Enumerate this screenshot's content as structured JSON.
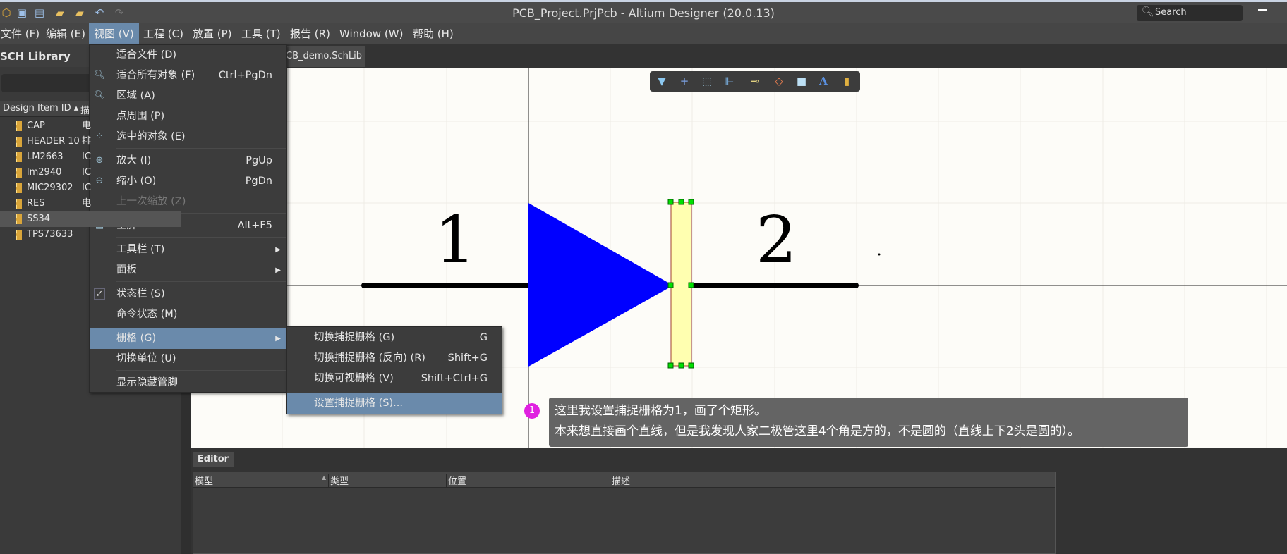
{
  "window": {
    "title": "PCB_Project.PrjPcb - Altium Designer (20.0.13)",
    "search_placeholder": "Search"
  },
  "quick_access": [
    "app-logo-icon",
    "save-icon",
    "save-all-icon",
    "open-icon",
    "open-project-icon",
    "undo-icon",
    "redo-icon"
  ],
  "menubar": [
    {
      "label": "文件 (F)"
    },
    {
      "label": "编辑 (E)"
    },
    {
      "label": "视图 (V)",
      "active": true
    },
    {
      "label": "工程 (C)"
    },
    {
      "label": "放置 (P)"
    },
    {
      "label": "工具 (T)"
    },
    {
      "label": "报告 (R)"
    },
    {
      "label": "Window (W)"
    },
    {
      "label": "帮助 (H)"
    }
  ],
  "left_panel": {
    "title": "SCH Library",
    "columns": [
      "Design Item ID",
      "描"
    ],
    "items": [
      {
        "id": "CAP",
        "desc": "电"
      },
      {
        "id": "HEADER 10",
        "desc": "排"
      },
      {
        "id": "LM2663",
        "desc": "IC"
      },
      {
        "id": "lm2940",
        "desc": "IC"
      },
      {
        "id": "MIC29302",
        "desc": "IC"
      },
      {
        "id": "RES",
        "desc": "电"
      },
      {
        "id": "SS34",
        "desc": "",
        "selected": true
      },
      {
        "id": "TPS73633",
        "desc": ""
      }
    ]
  },
  "doc_tab": {
    "label": "CB_demo.SchLib *"
  },
  "view_menu": [
    {
      "label": "适合文件 (D)",
      "shortcut": ""
    },
    {
      "label": "适合所有对象 (F)",
      "shortcut": "Ctrl+PgDn",
      "icon": "fit-all-icon"
    },
    {
      "label": "区域 (A)",
      "shortcut": "",
      "icon": "zoom-area-icon"
    },
    {
      "label": "点周围 (P)",
      "shortcut": ""
    },
    {
      "label": "选中的对象 (E)",
      "shortcut": "",
      "icon": "zoom-selected-icon"
    },
    {
      "label": "放大 (I)",
      "shortcut": "PgUp",
      "icon": "zoom-in-icon"
    },
    {
      "label": "缩小 (O)",
      "shortcut": "PgDn",
      "icon": "zoom-out-icon"
    },
    {
      "label": "上一次缩放 (Z)",
      "shortcut": "",
      "disabled": true
    },
    {
      "label": "全屏",
      "shortcut": "Alt+F5",
      "icon": "fullscreen-icon"
    },
    {
      "label": "工具栏 (T)",
      "submenu": true
    },
    {
      "label": "面板",
      "submenu": true
    },
    {
      "label": "状态栏 (S)",
      "checked": true
    },
    {
      "label": "命令状态 (M)"
    },
    {
      "label": "栅格 (G)",
      "submenu": true,
      "highlighted": true
    },
    {
      "label": "切换单位 (U)"
    },
    {
      "label": "显示隐藏管脚"
    }
  ],
  "grid_submenu": [
    {
      "label": "切换捕捉栅格 (G)",
      "shortcut": "G"
    },
    {
      "label": "切换捕捉栅格 (反向) (R)",
      "shortcut": "Shift+G"
    },
    {
      "label": "切换可视栅格 (V)",
      "shortcut": "Shift+Ctrl+G"
    },
    {
      "label": "设置捕捉栅格 (S)...",
      "shortcut": "",
      "highlighted": true
    }
  ],
  "toolbar_icons": [
    "filter-icon",
    "crosshair-icon",
    "select-rect-icon",
    "align-icon",
    "pin-icon",
    "eraser-icon",
    "rectangle-icon",
    "text-icon",
    "component-icon"
  ],
  "schematic": {
    "pin1_label": "1",
    "pin2_label": "2",
    "triangle_color": "#0000ff",
    "rect_fill": "#ffffb0",
    "handle_color": "#00e000"
  },
  "annotation": {
    "number": "1",
    "line1": "这里我设置捕捉栅格为1，画了个矩形。",
    "line2": "本来想直接画个直线，但是我发现人家二极管这里4个角是方的，不是圆的（直线上下2头是圆的）。"
  },
  "editor": {
    "tab": "Editor",
    "columns": [
      "模型",
      "类型",
      "位置",
      "描述"
    ]
  }
}
